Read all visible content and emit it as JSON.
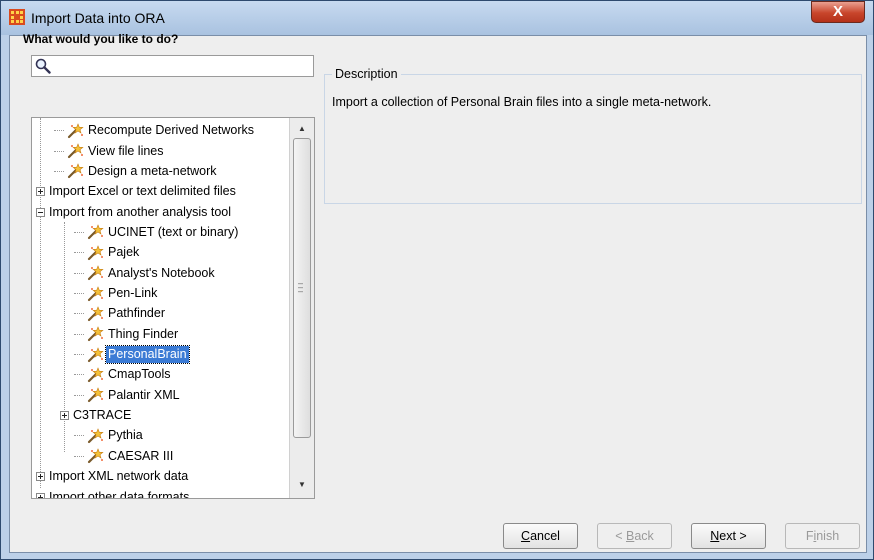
{
  "window": {
    "title": "Import Data into ORA",
    "close_glyph": "X"
  },
  "left": {
    "heading": "What would you like to do?",
    "search": {
      "value": "",
      "placeholder": ""
    },
    "tree": [
      {
        "label": "Recompute Derived Networks",
        "type": "leaf",
        "depth": 1
      },
      {
        "label": "View file lines",
        "type": "leaf",
        "depth": 1
      },
      {
        "label": "Design a meta-network",
        "type": "leaf",
        "depth": 1
      },
      {
        "label": "Import Excel or text delimited files",
        "type": "collapsed",
        "depth": 0
      },
      {
        "label": "Import from another analysis tool",
        "type": "expanded",
        "depth": 0
      },
      {
        "label": "UCINET (text or binary)",
        "type": "leaf",
        "depth": 2
      },
      {
        "label": "Pajek",
        "type": "leaf",
        "depth": 2
      },
      {
        "label": "Analyst's Notebook",
        "type": "leaf",
        "depth": 2
      },
      {
        "label": "Pen-Link",
        "type": "leaf",
        "depth": 2
      },
      {
        "label": "Pathfinder",
        "type": "leaf",
        "depth": 2
      },
      {
        "label": "Thing Finder",
        "type": "leaf",
        "depth": 2
      },
      {
        "label": "PersonalBrain",
        "type": "leaf",
        "depth": 2,
        "selected": true
      },
      {
        "label": "CmapTools",
        "type": "leaf",
        "depth": 2
      },
      {
        "label": "Palantir XML",
        "type": "leaf",
        "depth": 2
      },
      {
        "label": "C3TRACE",
        "type": "collapsed",
        "depth": 1
      },
      {
        "label": "Pythia",
        "type": "leaf",
        "depth": 2
      },
      {
        "label": "CAESAR III",
        "type": "leaf",
        "depth": 2
      },
      {
        "label": "Import XML network data",
        "type": "collapsed",
        "depth": 0
      },
      {
        "label": "Import other data formats",
        "type": "collapsed",
        "depth": 0
      }
    ]
  },
  "description": {
    "title": "Description",
    "text": "Import a collection of Personal Brain files into a single meta-network."
  },
  "buttons": {
    "cancel": {
      "label": "Cancel",
      "mnemonic": "C",
      "rest": "ancel"
    },
    "back": {
      "label": "< Back",
      "pre": "< ",
      "mnemonic": "B",
      "rest": "ack"
    },
    "next": {
      "label": "Next >",
      "mnemonic": "N",
      "rest": "ext >"
    },
    "finish": {
      "label": "Finish",
      "pre": "F",
      "mnemonic": "i",
      "rest": "nish"
    }
  },
  "colors": {
    "selection": "#3b7bd5",
    "titlebar": "#bcd0e8",
    "close": "#c8452b"
  },
  "icons": {
    "app": "ora-grid-icon",
    "search": "magnifier-icon",
    "item": "wand-icon"
  }
}
